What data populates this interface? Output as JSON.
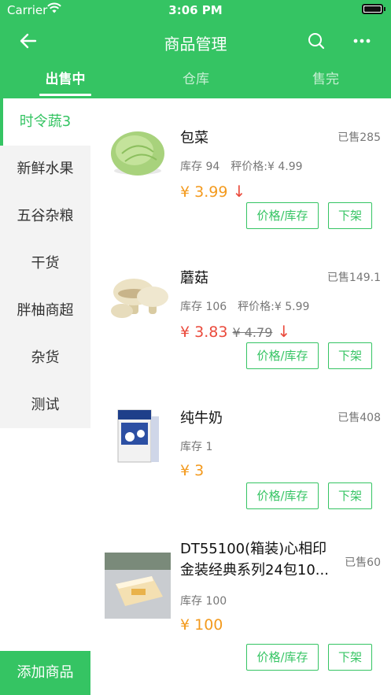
{
  "status_bar": {
    "carrier": "Carrier",
    "time": "3:06 PM"
  },
  "nav": {
    "title": "商品管理"
  },
  "tabs": [
    {
      "label": "出售中"
    },
    {
      "label": "仓库"
    },
    {
      "label": "售完"
    }
  ],
  "sidebar": {
    "items": [
      {
        "label": "时令蔬3"
      },
      {
        "label": "新鲜水果"
      },
      {
        "label": "五谷杂粮"
      },
      {
        "label": "干货"
      },
      {
        "label": "胖柚商超"
      },
      {
        "label": "杂货"
      },
      {
        "label": "测试"
      }
    ],
    "add_label": "添加商品"
  },
  "products": [
    {
      "name": "包菜",
      "sold": "已售285",
      "stock": "库存 94",
      "avg_price": "秤价格:¥ 4.99",
      "price": "¥ 3.99",
      "old_price": "",
      "price_down": true,
      "thumb": "cabbage"
    },
    {
      "name": "蘑菇",
      "sold": "已售149.1",
      "stock": "库存 106",
      "avg_price": "秤价格:¥ 5.99",
      "price": "¥ 3.83",
      "old_price": "¥ 4.79",
      "price_down": true,
      "thumb": "mushroom"
    },
    {
      "name": "纯牛奶",
      "sold": "已售408",
      "stock": "库存 1",
      "avg_price": "",
      "price": "¥ 3",
      "old_price": "",
      "price_down": false,
      "thumb": "milk"
    },
    {
      "name": "DT55100(箱装)心相印金装经典系列24包10...",
      "sold": "已售60",
      "stock": "库存 100",
      "avg_price": "",
      "price": "¥ 100",
      "old_price": "",
      "price_down": false,
      "thumb": "tissue"
    }
  ],
  "buttons": {
    "price_stock": "价格/库存",
    "off_shelf": "下架"
  },
  "icons": {
    "wifi": "wifi-icon",
    "battery": "battery-icon",
    "back": "back-arrow-icon",
    "search": "search-icon",
    "more": "more-icon",
    "down": "down-arrow-icon"
  },
  "colors": {
    "primary": "#35c463",
    "price": "#f39a1e",
    "price_down": "#ea4a3c"
  }
}
